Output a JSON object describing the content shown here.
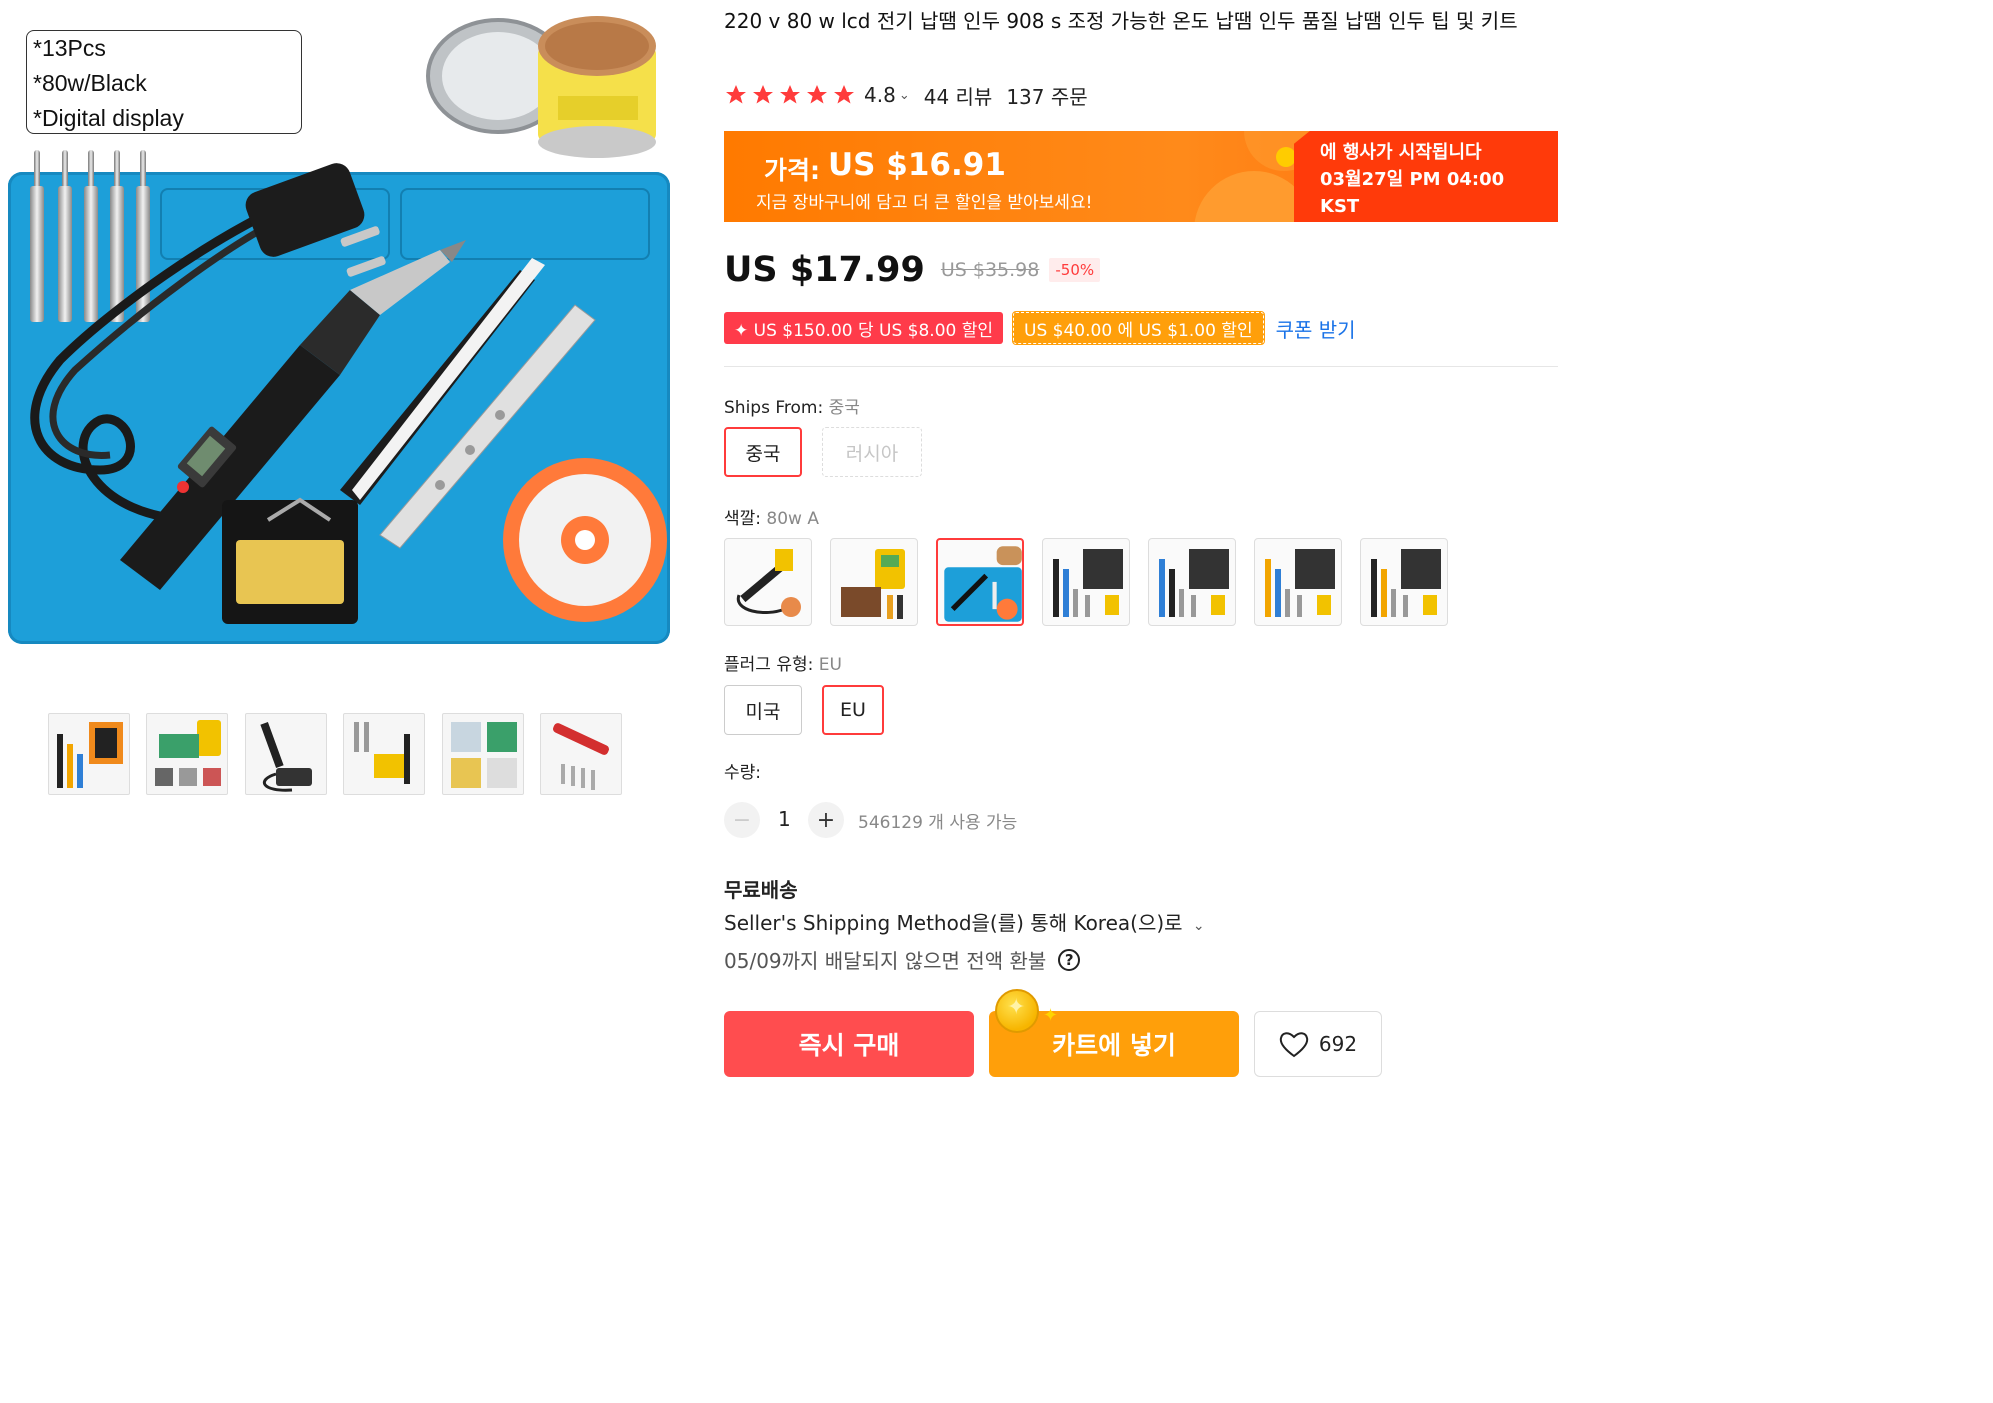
{
  "gallery": {
    "spec_lines": [
      "*13Pcs",
      "*80w/Black",
      "*Digital display"
    ],
    "thumbnail_count": 6
  },
  "product": {
    "title": "220 v 80 w lcd 전기 납땜 인두 908 s 조정 가능한 온도 납땜 인두 품질 납땜 인두 팁 및 키트",
    "rating": "4.8",
    "reviews": "44 리뷰",
    "orders": "137 주문"
  },
  "promo": {
    "price_label": "가격:",
    "price": "US $16.91",
    "subtitle": "지금 장바구니에 담고 더 큰 할인을 받아보세요!",
    "event_line1": "에 행사가 시작됩니다",
    "event_line2": "03월27일 PM 04:00",
    "event_line3": "KST"
  },
  "pricing": {
    "price": "US $17.99",
    "original": "US $35.98",
    "discount": "-50%"
  },
  "coupons": {
    "red": "✦ US $150.00 당 US $8.00 할인",
    "orange": "US $40.00 에 US $1.00 할인",
    "get": "쿠폰 받기"
  },
  "ships_from": {
    "label": "Ships From:",
    "selected": "중국",
    "options": [
      "중국",
      "러시아"
    ]
  },
  "color": {
    "label": "색깔:",
    "selected": "80w A",
    "swatch_count": 7,
    "selected_index": 2
  },
  "plug": {
    "label": "플러그 유형:",
    "selected": "EU",
    "options": [
      "미국",
      "EU"
    ]
  },
  "quantity": {
    "label": "수량:",
    "minus": "−",
    "value": "1",
    "plus": "+",
    "available": "546129 개 사용 가능"
  },
  "shipping": {
    "title": "무료배송",
    "method": "Seller's Shipping Method을(를) 통해 Korea(으)로",
    "refund": "05/09까지 배달되지 않으면 전액 환불",
    "help": "?"
  },
  "actions": {
    "buy_now": "즉시 구매",
    "add_to_cart": "카트에 넣기",
    "wishlist_count": "692"
  },
  "colors": {
    "accent_red": "#ff4d4f",
    "accent_orange": "#ff9f0a",
    "promo_orange": "#ff7a00",
    "link_blue": "#1a73e8",
    "star": "#ff3b3b"
  }
}
